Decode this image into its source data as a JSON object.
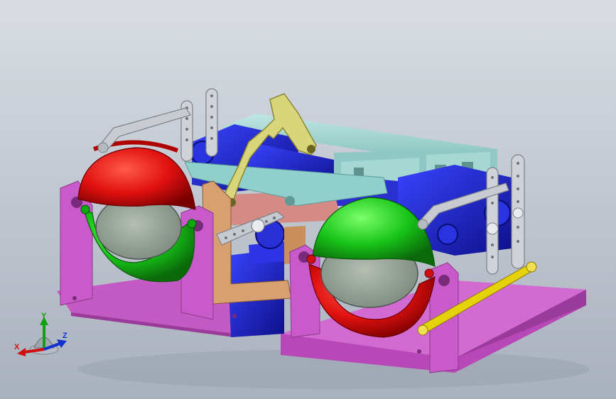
{
  "viewport": {
    "axes": {
      "x": "X",
      "y": "Y",
      "z": "Z"
    }
  },
  "colors": {
    "base_plate": "#cc55cc",
    "base_dark": "#a33aa3",
    "servo_blue": "#1e22c8",
    "frame_cyan": "#9fd4d0",
    "arm_grey": "#c8ccd2",
    "link_yellow": "#d6d46a",
    "eye_red": "#e01010",
    "eye_green": "#16c216",
    "lens_grey": "#9aa79a",
    "bracket_tan": "#d6a070",
    "rail_yellow": "#e5d000"
  }
}
